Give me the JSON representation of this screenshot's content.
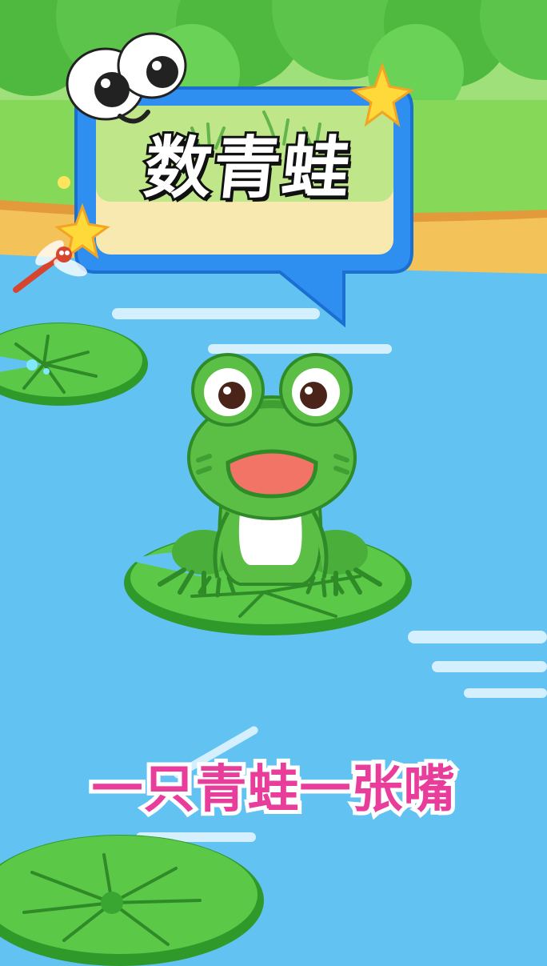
{
  "title": "数青蛙",
  "subtitle": "一只青蛙一张嘴",
  "colors": {
    "water": "#62c3f2",
    "grass": "#7fd34f",
    "frog_green": "#5cbf45",
    "lily_pad": "#4db83b",
    "subtitle_pink": "#e83d9a",
    "bubble_border": "#2f8ff0",
    "star_yellow": "#ffd83a"
  },
  "icons": [
    "googly-eyes-icon",
    "star-icon",
    "dragonfly-icon",
    "frog-icon",
    "lily-pad-icon"
  ]
}
